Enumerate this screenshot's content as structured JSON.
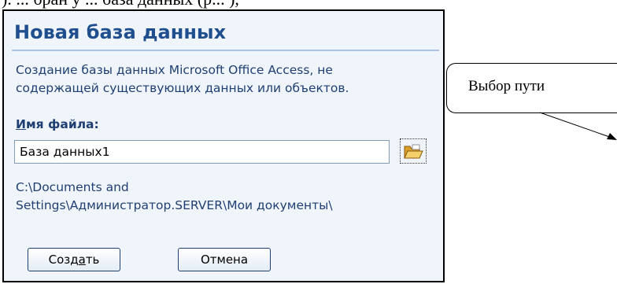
{
  "page": {
    "top_text": "). ... бран у ... база данных (р... ),"
  },
  "dialog": {
    "title": "Новая база данных",
    "description_lines": [
      "Создание базы данных Microsoft Office Access, не",
      "содержащей существующих данных или объектов."
    ],
    "filename_label_hotkey": "И",
    "filename_label_rest": "мя файла:",
    "filename_value": "База данных1",
    "path_lines": [
      "C:\\Documents and",
      "Settings\\Администратор.SERVER\\Мои документы\\"
    ],
    "create_button": {
      "before": "Созд",
      "hotkey": "а",
      "after": "ть"
    },
    "cancel_button": "Отмена"
  },
  "callout": {
    "text": "Выбор пути"
  },
  "colors": {
    "title": "#1f4f8f",
    "text": "#1f3f73",
    "panel_bg": "#f0f5fb",
    "folder_icon": "#e8b84a"
  }
}
